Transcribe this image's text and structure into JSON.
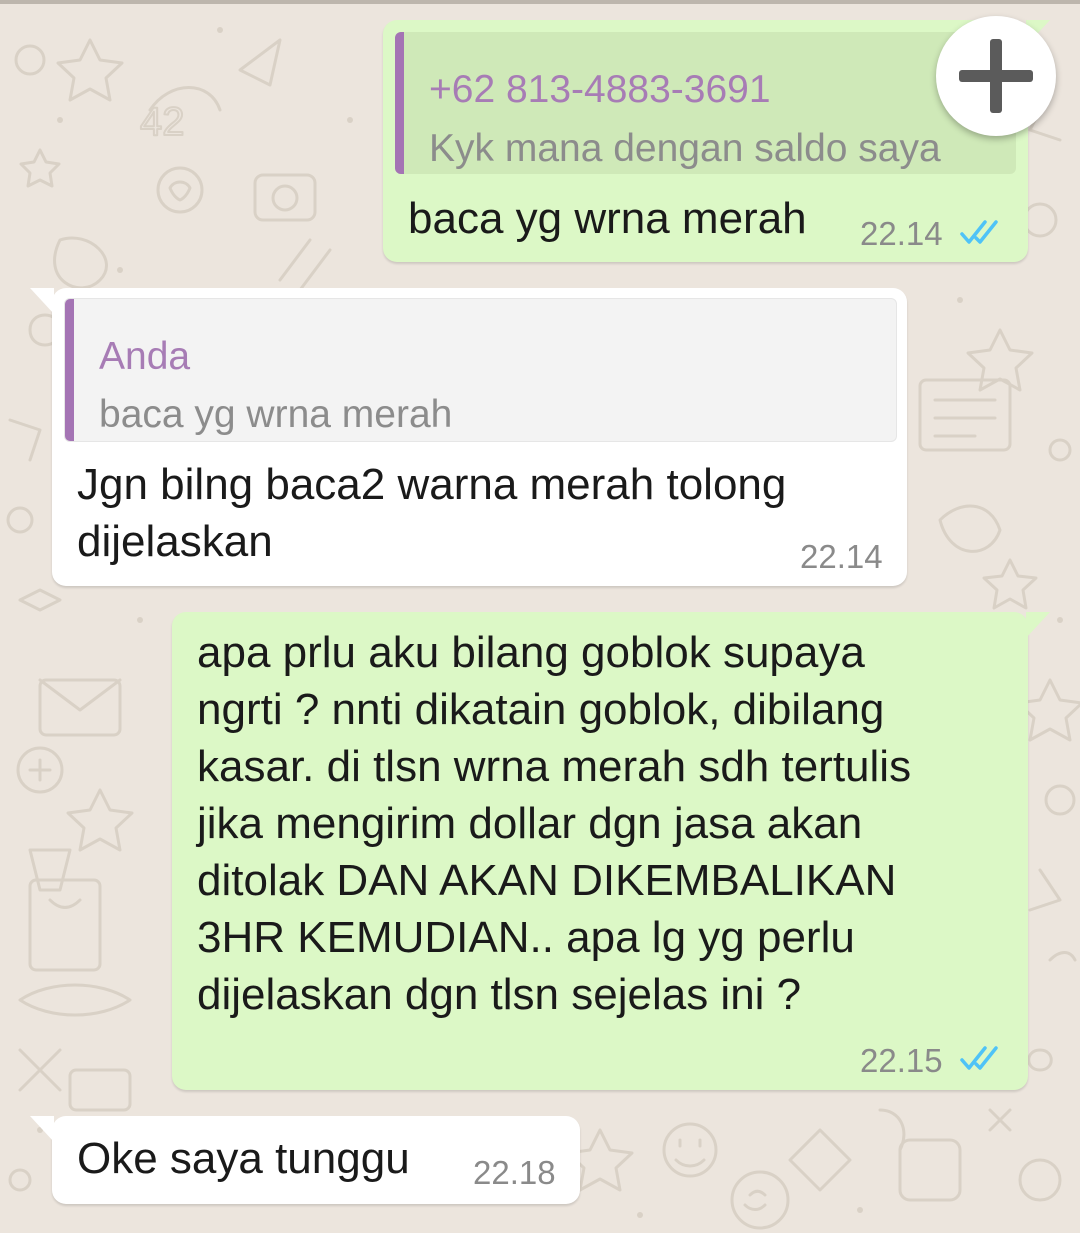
{
  "messages": [
    {
      "direction": "outgoing",
      "quote": {
        "author": "+62 813-4883-3691",
        "text": "Kyk mana dengan saldo saya"
      },
      "text": "baca yg wrna merah",
      "time": "22.14",
      "status": "read-double-check"
    },
    {
      "direction": "incoming",
      "quote": {
        "author": "Anda",
        "text": "baca yg wrna merah"
      },
      "text_lines": [
        "Jgn bilng baca2 warna merah tolong",
        "dijelaskan"
      ],
      "time": "22.14"
    },
    {
      "direction": "outgoing",
      "text_lines": [
        "apa prlu aku bilang goblok supaya",
        "ngrti ? nnti dikatain goblok, dibilang",
        "kasar. di tlsn wrna merah sdh tertulis",
        "jika mengirim dollar dgn jasa akan",
        "ditolak DAN AKAN DIKEMBALIKAN",
        "3HR KEMUDIAN.. apa lg yg perlu",
        "dijelaskan dgn tlsn sejelas ini ?"
      ],
      "time": "22.15",
      "status": "read-double-check"
    },
    {
      "direction": "incoming",
      "text": "Oke saya tunggu",
      "time": "22.18"
    }
  ],
  "fab": {
    "icon": "plus-icon"
  },
  "colors": {
    "outgoing_bubble": "#dcf8c6",
    "incoming_bubble": "#ffffff",
    "quote_accent": "#a474b4",
    "read_ticks": "#4fc3f7",
    "wallpaper": "#ece5dd"
  }
}
